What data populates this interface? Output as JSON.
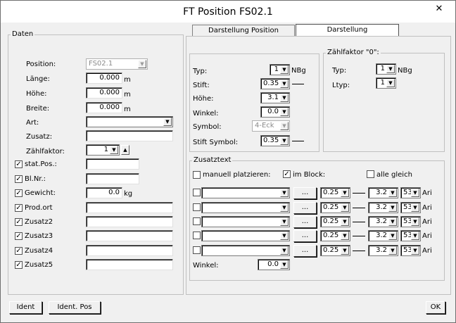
{
  "window": {
    "title": "FT Position FS02.1",
    "close": "✕"
  },
  "tabs": {
    "tab1": "Darstellung Position",
    "tab2": "Darstellung"
  },
  "daten": {
    "legend": "Daten",
    "position_label": "Position:",
    "position_value": "FS02.1",
    "laenge_label": "Länge:",
    "laenge_value": "0.000",
    "laenge_unit": "m",
    "hoehe_label": "Höhe:",
    "hoehe_value": "0.000",
    "hoehe_unit": "m",
    "breite_label": "Breite:",
    "breite_value": "0.000",
    "breite_unit": "m",
    "art_label": "Art:",
    "art_value": "",
    "zusatz_label": "Zusatz:",
    "zusatz_value": "",
    "zaehlfaktor_label": "Zählfaktor:",
    "zaehlfaktor_value": "1",
    "statpos_label": "stat.Pos.:",
    "blnr_label": "Bl.Nr.:",
    "gewicht_label": "Gewicht:",
    "gewicht_value": "0.0",
    "gewicht_unit": "kg",
    "prodort_label": "Prod.ort",
    "zusatz2_label": "Zusatz2",
    "zusatz3_label": "Zusatz3",
    "zusatz4_label": "Zusatz4",
    "zusatz5_label": "Zusatz5"
  },
  "darstellung": {
    "typ_label": "Typ:",
    "typ_value": "1",
    "typ_unit": "NBg",
    "stift_label": "Stift:",
    "stift_value": "0.35",
    "hoehe_label": "Höhe:",
    "hoehe_value": "3.1",
    "winkel_label": "Winkel:",
    "winkel_value": "0.0",
    "symbol_label": "Symbol:",
    "symbol_value": "4-Eck",
    "stiftsymbol_label": "Stift Symbol:",
    "stiftsymbol_value": "0.35"
  },
  "zaehl0": {
    "legend": "Zählfaktor \"0\":",
    "typ_label": "Typ:",
    "typ_value": "1",
    "typ_unit": "NBg",
    "ltyp_label": "Ltyp:",
    "ltyp_value": "1"
  },
  "zusatztext": {
    "legend": "Zusatztext",
    "manuell_label": "manuell platzieren:",
    "imblock_label": "im Block:",
    "allegleich_label": "alle gleich",
    "browse": "...",
    "stift": "0.25",
    "hoehe": "3.2",
    "font": "53",
    "fontname": "Ari",
    "winkel_label": "Winkel:",
    "winkel_value": "0.0"
  },
  "footer": {
    "ident": "Ident",
    "identpos": "Ident. Pos",
    "ok": "OK"
  }
}
